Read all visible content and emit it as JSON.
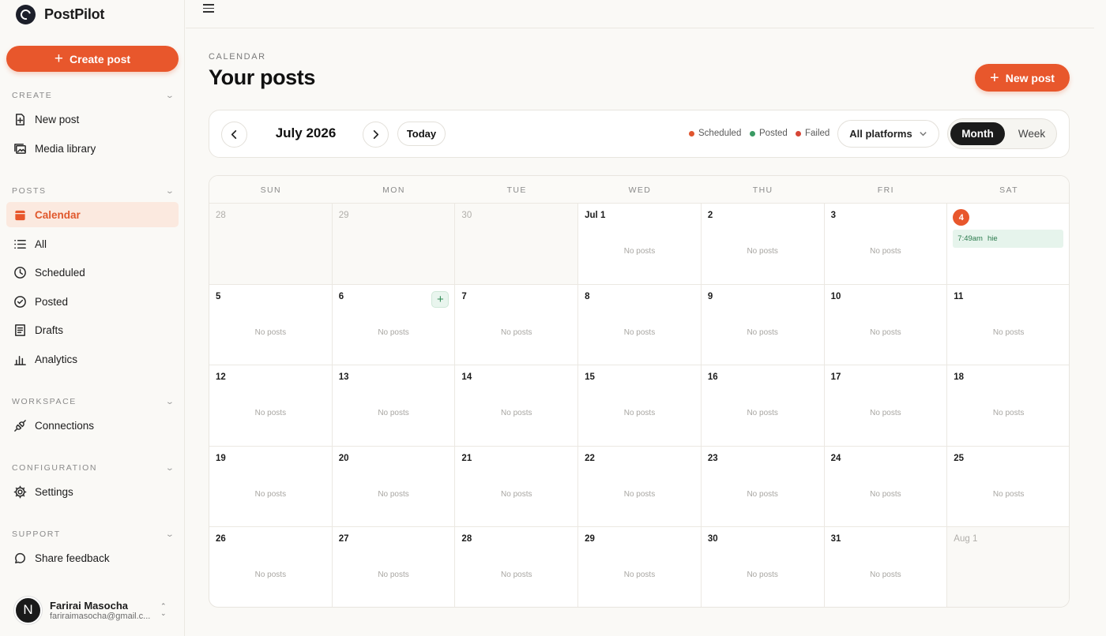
{
  "brand": {
    "name": "PostPilot"
  },
  "sidebar": {
    "create_button": "Create post",
    "sections": [
      {
        "title": "CREATE",
        "items": [
          {
            "label": "New post",
            "icon": "new-post-icon"
          },
          {
            "label": "Media library",
            "icon": "media-library-icon"
          }
        ]
      },
      {
        "title": "POSTS",
        "items": [
          {
            "label": "Calendar",
            "icon": "calendar-icon",
            "active": true
          },
          {
            "label": "All",
            "icon": "list-icon"
          },
          {
            "label": "Scheduled",
            "icon": "clock-icon"
          },
          {
            "label": "Posted",
            "icon": "check-circle-icon"
          },
          {
            "label": "Drafts",
            "icon": "drafts-icon"
          },
          {
            "label": "Analytics",
            "icon": "analytics-icon"
          }
        ]
      },
      {
        "title": "WORKSPACE",
        "items": [
          {
            "label": "Connections",
            "icon": "plug-icon"
          }
        ]
      },
      {
        "title": "CONFIGURATION",
        "items": [
          {
            "label": "Settings",
            "icon": "gear-icon"
          }
        ]
      },
      {
        "title": "SUPPORT",
        "items": [
          {
            "label": "Share feedback",
            "icon": "chat-bubble-icon"
          }
        ]
      }
    ],
    "user": {
      "initial": "N",
      "name": "Farirai Masocha",
      "email": "fariraimasocha@gmail.c..."
    }
  },
  "header": {
    "eyebrow": "CALENDAR",
    "title": "Your posts",
    "new_post_button": "New post"
  },
  "toolbar": {
    "month_label": "July 2026",
    "today_button": "Today",
    "legend": [
      {
        "label": "Scheduled",
        "color": "#e0552e"
      },
      {
        "label": "Posted",
        "color": "#3a9a63"
      },
      {
        "label": "Failed",
        "color": "#d64536"
      }
    ],
    "platform_filter": "All platforms",
    "view_month": "Month",
    "view_week": "Week"
  },
  "calendar": {
    "weekdays": [
      "SUN",
      "MON",
      "TUE",
      "WED",
      "THU",
      "FRI",
      "SAT"
    ],
    "no_posts_label": "No posts",
    "weeks": [
      [
        {
          "label": "28",
          "outside": true
        },
        {
          "label": "29",
          "outside": true
        },
        {
          "label": "30",
          "outside": true
        },
        {
          "label": "Jul 1"
        },
        {
          "label": "2"
        },
        {
          "label": "3"
        },
        {
          "label": "4",
          "today": true,
          "events": [
            {
              "time": "7:49am",
              "title": "hie"
            }
          ]
        }
      ],
      [
        {
          "label": "5"
        },
        {
          "label": "6",
          "hover_add": true
        },
        {
          "label": "7"
        },
        {
          "label": "8"
        },
        {
          "label": "9"
        },
        {
          "label": "10"
        },
        {
          "label": "11"
        }
      ],
      [
        {
          "label": "12"
        },
        {
          "label": "13"
        },
        {
          "label": "14"
        },
        {
          "label": "15"
        },
        {
          "label": "16"
        },
        {
          "label": "17"
        },
        {
          "label": "18"
        }
      ],
      [
        {
          "label": "19"
        },
        {
          "label": "20"
        },
        {
          "label": "21"
        },
        {
          "label": "22"
        },
        {
          "label": "23"
        },
        {
          "label": "24"
        },
        {
          "label": "25"
        }
      ],
      [
        {
          "label": "26"
        },
        {
          "label": "27"
        },
        {
          "label": "28"
        },
        {
          "label": "29"
        },
        {
          "label": "30"
        },
        {
          "label": "31"
        },
        {
          "label": "Aug 1",
          "outside": true
        }
      ]
    ]
  }
}
